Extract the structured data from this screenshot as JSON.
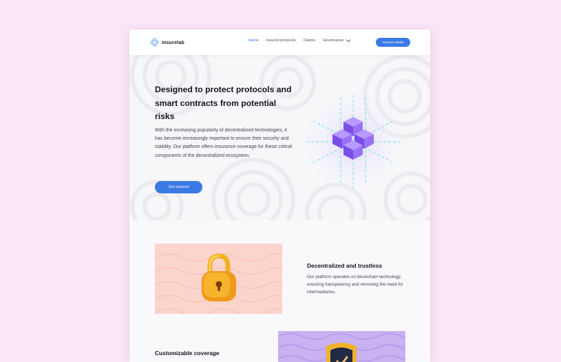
{
  "brand": {
    "name": "insurelab"
  },
  "nav": {
    "links": [
      "Home",
      "Insured protocols",
      "Claims"
    ],
    "governance": "Governance",
    "wallet_button": "Connect Wallet"
  },
  "hero": {
    "title": "Designed to protect protocols and smart contracts from potential risks",
    "text": "With the increasing popularity of decentralized technologies, it has become increasingly important to ensure their security and stability. Our platform offers insurance coverage for these critical components of the decentralized ecosystem.",
    "cta": "Get insured"
  },
  "features": [
    {
      "title": "Decentralized and trustless",
      "text": "Our platform operates on blockchain technology, ensuring transparency and removing the need for intermediaries."
    },
    {
      "title": "Customizable coverage"
    }
  ],
  "colors": {
    "accent": "#3b7ae4",
    "page_bg": "#fbe6f6",
    "cube": "#8e63f0",
    "lock": "#f0a522"
  },
  "icons": [
    "logo-diamond-icon",
    "chevron-down-icon",
    "blockchain-cubes-illustration",
    "padlock-illustration",
    "shield-check-illustration"
  ]
}
